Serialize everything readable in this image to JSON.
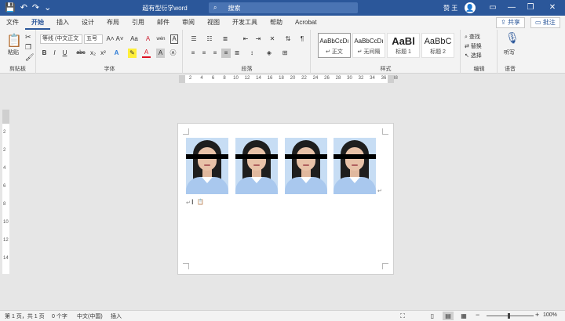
{
  "titlebar": {
    "title": "超有型衍学word",
    "search_placeholder": "搜索",
    "user_name": "赞 王",
    "avatar_glyph": "👤",
    "minimize": "—",
    "restore": "❐",
    "close": "✕"
  },
  "tabs": [
    "文件",
    "开始",
    "插入",
    "设计",
    "布局",
    "引用",
    "邮件",
    "审阅",
    "视图",
    "开发工具",
    "帮助",
    "Acrobat"
  ],
  "tabs_right": {
    "share": "共享",
    "comments": "批注"
  },
  "ribbon": {
    "clipboard": {
      "label": "剪贴板",
      "paste": "粘贴"
    },
    "font": {
      "label": "字体",
      "font_name": "等线 (中文正文",
      "font_size": "五号",
      "grow": "A˄",
      "shrink": "A˅",
      "case": "Aa",
      "clear": "A",
      "wen": "wén",
      "border_a": "A",
      "bold": "B",
      "italic": "I",
      "underline": "U",
      "strike": "abc",
      "sub": "x₂",
      "sup": "x²",
      "effects": "A",
      "highlight": "✎",
      "color": "A",
      "shade": "A",
      "circle": "Ⓐ"
    },
    "paragraph": {
      "label": "段落"
    },
    "styles": {
      "label": "样式",
      "items": [
        {
          "preview": "AaBbCcDı",
          "name": "↵ 正文"
        },
        {
          "preview": "AaBbCcDı",
          "name": "↵ 无间隔"
        },
        {
          "preview": "AaBl",
          "name": "标题 1"
        },
        {
          "preview": "AaBbC",
          "name": "标题 2"
        }
      ]
    },
    "editing": {
      "label": "编辑",
      "find": "查找",
      "replace": "替换",
      "select": "选择"
    },
    "voice": {
      "label": "语音",
      "dictate": "听写"
    }
  },
  "document": {
    "paragraph_mark": "↵",
    "cursor": "I",
    "end_mark": "↵"
  },
  "statusbar": {
    "page": "第 1 页，共 1 页",
    "words": "0 个字",
    "language": "中文(中国)",
    "mode": "插入",
    "zoom": "100%"
  },
  "hruler_numbers": [
    "2",
    "2",
    "4",
    "6",
    "8",
    "10",
    "12",
    "14",
    "16",
    "18",
    "20",
    "22",
    "24",
    "26",
    "28",
    "30",
    "32",
    "34",
    "36",
    "38"
  ],
  "vruler_numbers": [
    "2",
    "2",
    "4",
    "6",
    "8",
    "10",
    "12",
    "14"
  ]
}
